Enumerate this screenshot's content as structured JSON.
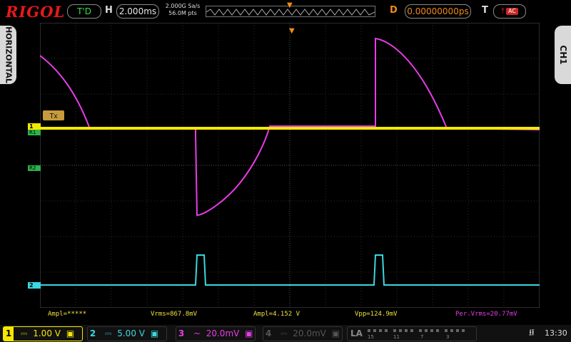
{
  "header": {
    "brand": "RIGOL",
    "trigger_status": "T'D",
    "h_label": "H",
    "timebase": "2.000ms",
    "sample_rate": "2.000G Sa/s",
    "memory_depth": "56.0M pts",
    "d_label": "D",
    "delay": "0.00000000ps",
    "t_label": "T",
    "trigger_source": "AC"
  },
  "side": {
    "left": "HORIZONTAL",
    "right": "CH1"
  },
  "markers": {
    "tx": "Tx",
    "ch1": "1",
    "r1": "R1",
    "r2": "R2",
    "ch2": "2"
  },
  "measurements": [
    {
      "text": "Ampl=*****",
      "color": "#f0e23a"
    },
    {
      "text": "Vrms=867.8mV",
      "color": "#f0e23a"
    },
    {
      "text": "Ampl=4.152 V",
      "color": "#f0e23a"
    },
    {
      "text": "Vpp=124.9mV",
      "color": "#f0e23a"
    },
    {
      "text": "Per.Vrms=20.77mV",
      "color": "#e83ce8"
    }
  ],
  "channels": [
    {
      "num": "1",
      "coupling": "⎓",
      "scale": "1.00 V",
      "color": "#f5e800",
      "active": true
    },
    {
      "num": "2",
      "coupling": "⎓",
      "scale": "5.00 V",
      "color": "#3bd8df",
      "active": true
    },
    {
      "num": "3",
      "coupling": "~",
      "scale": "20.0mV",
      "color": "#e83ce8",
      "active": true
    },
    {
      "num": "4",
      "coupling": "⎓",
      "scale": "20.0mV",
      "color": "#555555",
      "active": false
    }
  ],
  "la": {
    "label": "LA",
    "digits": [
      "15",
      "11",
      "7",
      "3"
    ]
  },
  "status": {
    "time": "13:30"
  },
  "colors": {
    "ch1": "#f5e800",
    "ch2": "#3bd8df",
    "ch3": "#e83ce8",
    "grid": "#333333",
    "trigger": "#f08a1a"
  }
}
